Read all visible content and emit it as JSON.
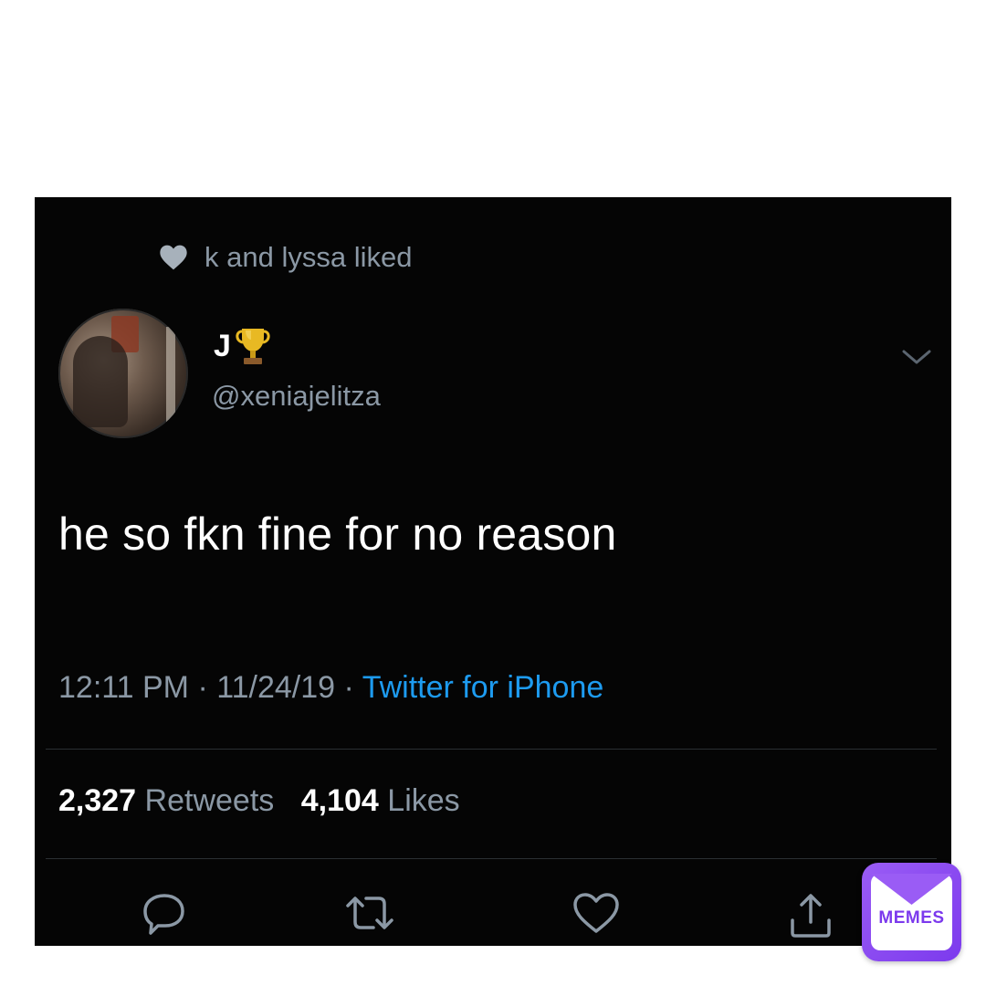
{
  "tweet": {
    "liked_by": "k and lyssa liked",
    "display_name": "J",
    "display_name_emoji": "trophy-emoji",
    "handle": "@xeniajelitza",
    "text": "he so fkn fine for no reason",
    "time": "12:11 PM",
    "separator": "·",
    "date": "11/24/19",
    "source": "Twitter for iPhone",
    "retweets_count": "2,327",
    "retweets_label": "Retweets",
    "likes_count": "4,104",
    "likes_label": "Likes"
  },
  "actions": {
    "reply_icon": "speech-bubble-icon",
    "retweet_icon": "retweet-arrows-icon",
    "like_icon": "heart-outline-icon",
    "share_icon": "share-upload-icon"
  },
  "watermark": {
    "label": "MEMES"
  },
  "colors": {
    "card_bg": "#050505",
    "text_primary": "#ffffff",
    "text_secondary": "#8b98a5",
    "link_blue": "#1d9bf0",
    "badge_purple": "#7c3aed"
  }
}
